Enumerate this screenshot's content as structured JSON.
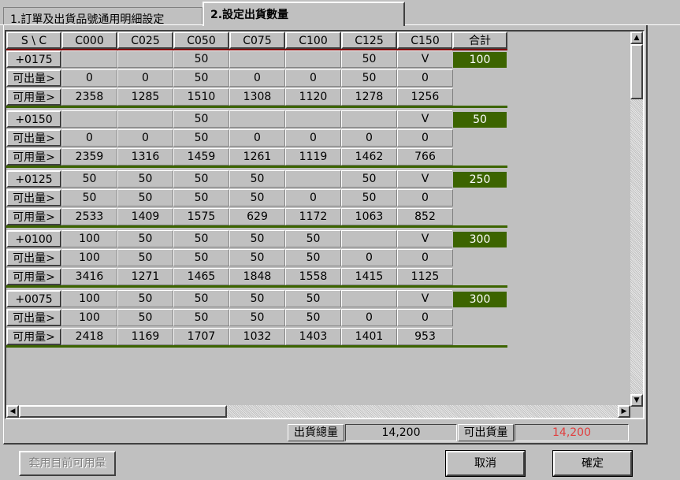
{
  "tabs": [
    {
      "label": "1.訂單及出貨品號通用明細設定",
      "active": false
    },
    {
      "label": "2.設定出貨數量",
      "active": true
    }
  ],
  "grid": {
    "corner": "S \\ C",
    "columns": [
      "C000",
      "C025",
      "C050",
      "C075",
      "C100",
      "C125",
      "C150"
    ],
    "total_header": "合計",
    "groups": [
      {
        "size": "+0175",
        "order": [
          "",
          "",
          "50",
          "",
          "",
          "50",
          "V"
        ],
        "total": "100",
        "avail_label": "可出量>",
        "avail": [
          "0",
          "0",
          "50",
          "0",
          "0",
          "50",
          "0"
        ],
        "usable_label": "可用量>",
        "usable": [
          "2358",
          "1285",
          "1510",
          "1308",
          "1120",
          "1278",
          "1256"
        ]
      },
      {
        "size": "+0150",
        "order": [
          "",
          "",
          "50",
          "",
          "",
          "",
          "V"
        ],
        "total": "50",
        "avail_label": "可出量>",
        "avail": [
          "0",
          "0",
          "50",
          "0",
          "0",
          "0",
          "0"
        ],
        "usable_label": "可用量>",
        "usable": [
          "2359",
          "1316",
          "1459",
          "1261",
          "1119",
          "1462",
          "766"
        ]
      },
      {
        "size": "+0125",
        "order": [
          "50",
          "50",
          "50",
          "50",
          "",
          "50",
          "V"
        ],
        "total": "250",
        "avail_label": "可出量>",
        "avail": [
          "50",
          "50",
          "50",
          "50",
          "0",
          "50",
          "0"
        ],
        "usable_label": "可用量>",
        "usable": [
          "2533",
          "1409",
          "1575",
          "629",
          "1172",
          "1063",
          "852"
        ]
      },
      {
        "size": "+0100",
        "order": [
          "100",
          "50",
          "50",
          "50",
          "50",
          "",
          "V"
        ],
        "total": "300",
        "avail_label": "可出量>",
        "avail": [
          "100",
          "50",
          "50",
          "50",
          "50",
          "0",
          "0"
        ],
        "usable_label": "可用量>",
        "usable": [
          "3416",
          "1271",
          "1465",
          "1848",
          "1558",
          "1415",
          "1125"
        ]
      },
      {
        "size": "+0075",
        "order": [
          "100",
          "50",
          "50",
          "50",
          "50",
          "",
          "V"
        ],
        "total": "300",
        "avail_label": "可出量>",
        "avail": [
          "100",
          "50",
          "50",
          "50",
          "50",
          "0",
          "0"
        ],
        "usable_label": "可用量>",
        "usable": [
          "2418",
          "1169",
          "1707",
          "1032",
          "1403",
          "1401",
          "953"
        ]
      }
    ]
  },
  "summary": {
    "ship_total_label": "出貨總量",
    "ship_total_value": "14,200",
    "available_label": "可出貨量",
    "available_value": "14,200"
  },
  "buttons": {
    "apply_usable": "套用目前可用量",
    "cancel": "取消",
    "confirm": "確定"
  },
  "colors": {
    "total_bg": "#3c6400",
    "available_value": "#e04040",
    "separator": "#3c6400"
  }
}
